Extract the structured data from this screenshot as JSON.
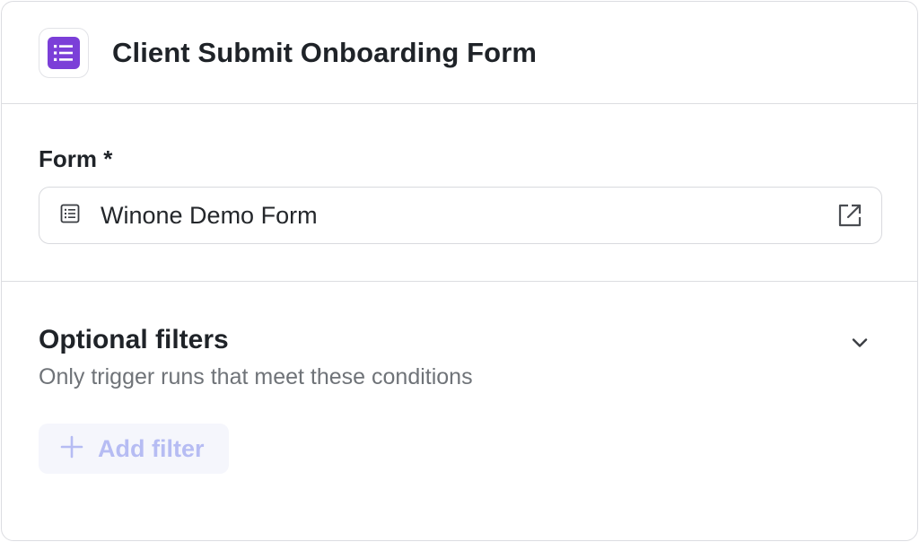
{
  "header": {
    "title": "Client Submit Onboarding Form",
    "icon": "form-list-icon",
    "icon_color": "#7b3fd8"
  },
  "form_field": {
    "label": "Form *",
    "value": "Winone Demo Form",
    "leading_icon": "list-doc-icon",
    "trailing_icon": "external-link-icon"
  },
  "filters": {
    "title": "Optional filters",
    "subtitle": "Only trigger runs that meet these conditions",
    "toggle_icon": "chevron-down-icon",
    "add_button_label": "Add filter",
    "add_button_icon": "plus-icon",
    "add_button_color": "#b6bcf3"
  }
}
